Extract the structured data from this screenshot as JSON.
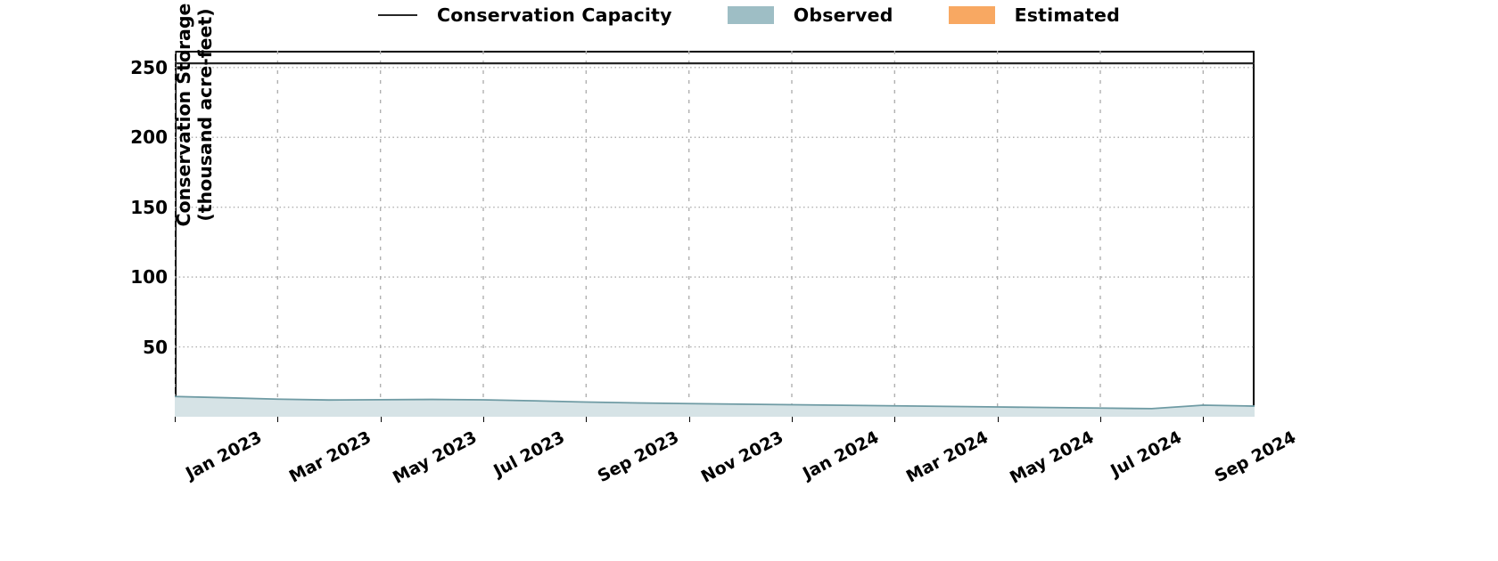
{
  "legend": {
    "entries": [
      {
        "label": "Conservation Capacity",
        "marker": "line",
        "color": "#262626"
      },
      {
        "label": "Observed",
        "marker": "patch",
        "color": "#9ebec5"
      },
      {
        "label": "Estimated",
        "marker": "patch",
        "color": "#f8a862"
      }
    ]
  },
  "axes": {
    "ylabel_line1": "Conservation Storage",
    "ylabel_line2": "(thousand acre-feet)",
    "yticks": [
      "50",
      "100",
      "150",
      "200",
      "250"
    ],
    "xticks": [
      "Jan 2023",
      "Mar 2023",
      "May 2023",
      "Jul 2023",
      "Sep 2023",
      "Nov 2023",
      "Jan 2024",
      "Mar 2024",
      "May 2024",
      "Jul 2024",
      "Sep 2024"
    ]
  },
  "chart_data": {
    "type": "area",
    "title": "",
    "xlabel": "",
    "ylabel": "Conservation Storage (thousand acre-feet)",
    "ylim": [
      0,
      262
    ],
    "yticks": [
      50,
      100,
      150,
      200,
      250
    ],
    "grid": true,
    "legend_position": "top-center",
    "x_start": "2023-01-01",
    "x_end": "2024-10-15",
    "xtick_labels": [
      "Jan 2023",
      "Mar 2023",
      "May 2023",
      "Jul 2023",
      "Sep 2023",
      "Nov 2023",
      "Jan 2024",
      "Mar 2024",
      "May 2024",
      "Jul 2024",
      "Sep 2024"
    ],
    "conservation_capacity": 253.0,
    "series": [
      {
        "name": "Observed",
        "color": "#9ebec5",
        "fill_color": "#d6e3e6",
        "x": [
          "2023-01",
          "2023-02",
          "2023-03",
          "2023-04",
          "2023-05",
          "2023-06",
          "2023-07",
          "2023-08",
          "2023-09",
          "2023-10",
          "2023-11",
          "2023-12",
          "2024-01",
          "2024-02",
          "2024-03",
          "2024-04",
          "2024-05",
          "2024-06",
          "2024-07",
          "2024-08",
          "2024-09",
          "2024-10"
        ],
        "values": [
          14.5,
          13.6,
          12.6,
          12.0,
          12.2,
          12.4,
          12.1,
          11.4,
          10.5,
          9.9,
          9.4,
          9.0,
          8.6,
          8.2,
          7.8,
          7.4,
          7.0,
          6.6,
          6.2,
          5.8,
          8.3,
          7.6
        ]
      },
      {
        "name": "Estimated",
        "color": "#f8a862",
        "fill_color": "#fbd7b2",
        "x": [],
        "values": []
      }
    ]
  }
}
